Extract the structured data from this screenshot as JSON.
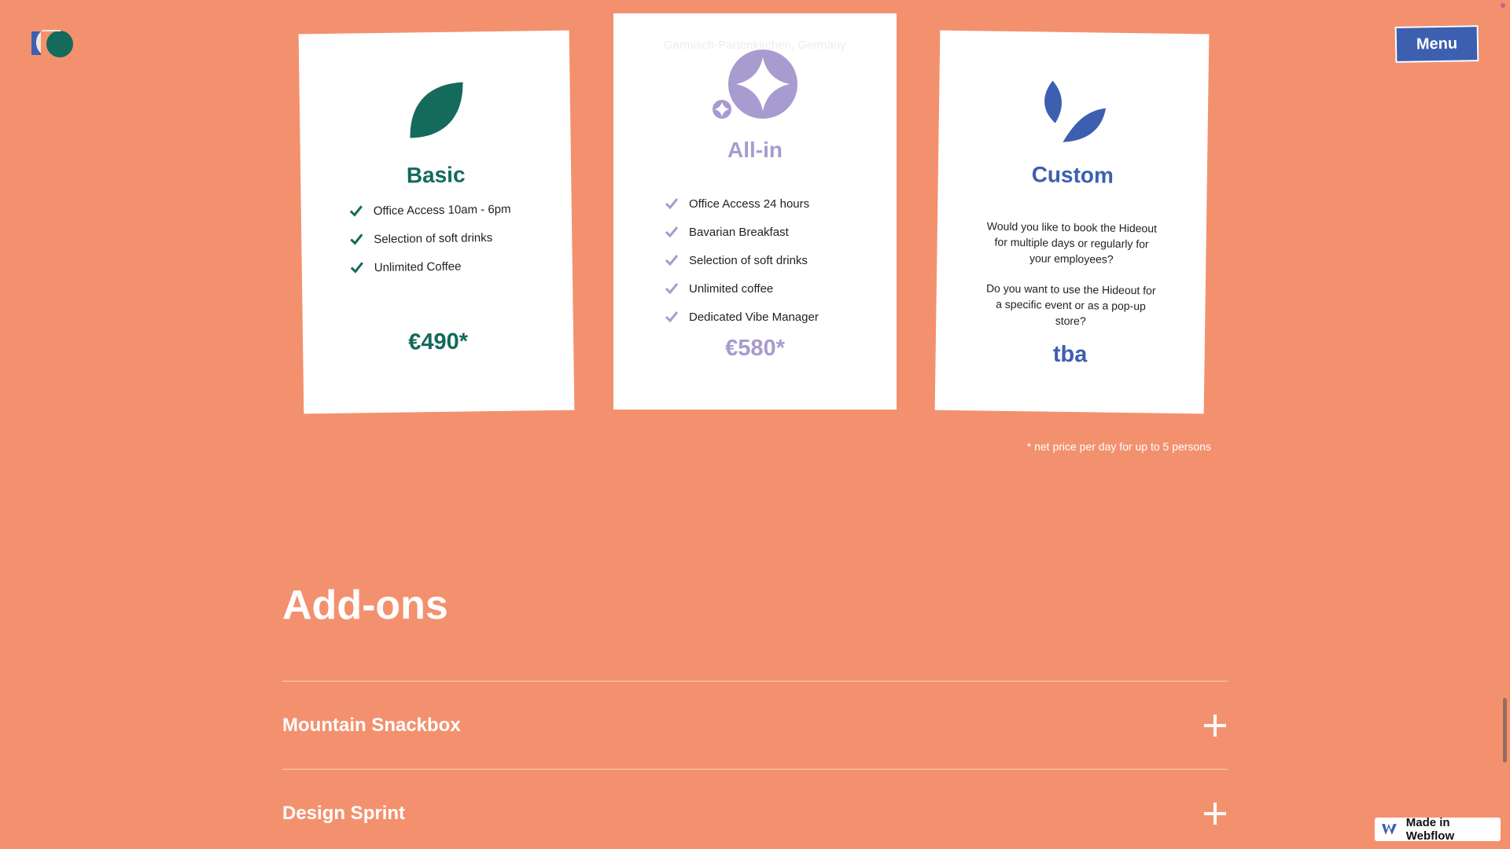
{
  "header": {
    "menu_label": "Menu",
    "logo_icon": "studio-logo-icon"
  },
  "plans": [
    {
      "name": "Basic",
      "icon": "leaf-icon",
      "color": "#146A5B",
      "features": [
        "Office Access 10am - 6pm",
        "Selection of soft drinks",
        "Unlimited Coffee"
      ],
      "price": "€490*"
    },
    {
      "name": "All-in",
      "icon": "star-icon",
      "color": "#A89BCF",
      "location": "Garmisch-Partenkirchen, Germany",
      "features": [
        "Office Access 24 hours",
        "Bavarian Breakfast",
        "Selection of soft drinks",
        "Unlimited coffee",
        "Dedicated Vibe Manager"
      ],
      "price": "€580*"
    },
    {
      "name": "Custom",
      "icon": "double-leaf-icon",
      "color": "#3D5FB0",
      "description": [
        "Would you like to book the Hideout for multiple days or regularly for your employees?",
        "Do you want to use the Hideout for a specific event or as a pop-up store?"
      ],
      "price": "tba"
    }
  ],
  "note": "* net price per day for up to 5 persons",
  "addons": {
    "title": "Add-ons",
    "items": [
      {
        "label": "Mountain Snackbox"
      },
      {
        "label": "Design Sprint"
      }
    ]
  },
  "badge": {
    "label": "Made in Webflow"
  }
}
